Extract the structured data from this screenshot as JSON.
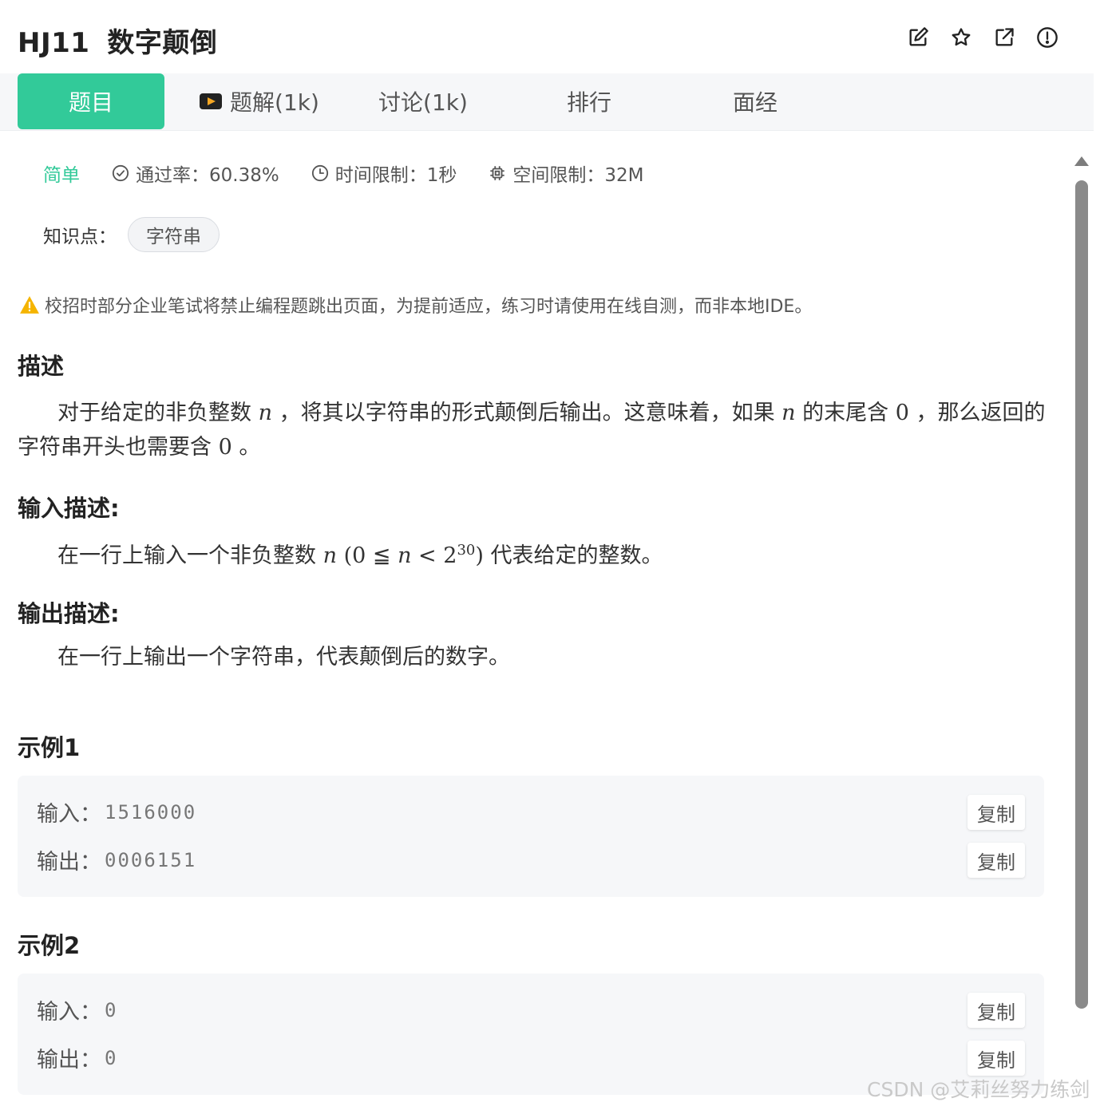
{
  "header": {
    "problem_id": "HJ11",
    "problem_title": "数字颠倒",
    "icons": [
      "edit-icon",
      "star-icon",
      "external-link-icon",
      "report-icon"
    ]
  },
  "tabs": [
    {
      "label": "题目",
      "active": true
    },
    {
      "label": "题解(1k)",
      "icon": "video-icon"
    },
    {
      "label": "讨论(1k)"
    },
    {
      "label": "排行"
    },
    {
      "label": "面经"
    }
  ],
  "meta": {
    "difficulty": "简单",
    "pass_rate": "通过率：60.38%",
    "time_limit": "时间限制：1秒",
    "memory_limit": "空间限制：32M"
  },
  "knowledge": {
    "label": "知识点：",
    "tags": [
      "字符串"
    ]
  },
  "warning": "校招时部分企业笔试将禁止编程题跳出页面，为提前适应，练习时请使用在线自测，而非本地IDE。",
  "description": {
    "title": "描述",
    "text_1": "对于给定的非负整数",
    "var_n": "n",
    "text_2": "，将其以字符串的形式颠倒后输出。这意味着，如果",
    "text_3": "的末尾含",
    "zero": "0",
    "text_4": "，那么返回的字符串开头也需要含",
    "text_5": "。"
  },
  "input_desc": {
    "title": "输入描述:",
    "text_1": "在一行上输入一个非负整数",
    "constraint_left": "(0 ≦ ",
    "constraint_mid": "n",
    "constraint_right": " < 2",
    "exponent": "30",
    "constraint_close": ")",
    "text_2": "代表给定的整数。"
  },
  "output_desc": {
    "title": "输出描述:",
    "text": "在一行上输出一个字符串，代表颠倒后的数字。"
  },
  "examples": [
    {
      "title": "示例1",
      "input_label": "输入：",
      "input": "1516000",
      "output_label": "输出：",
      "output": "0006151",
      "copy_label": "复制"
    },
    {
      "title": "示例2",
      "input_label": "输入：",
      "input": "0",
      "output_label": "输出：",
      "output": "0",
      "copy_label": "复制"
    }
  ],
  "watermark": "CSDN @艾莉丝努力练剑",
  "colors": {
    "accent": "#32ca99",
    "warning": "#f5b400"
  }
}
